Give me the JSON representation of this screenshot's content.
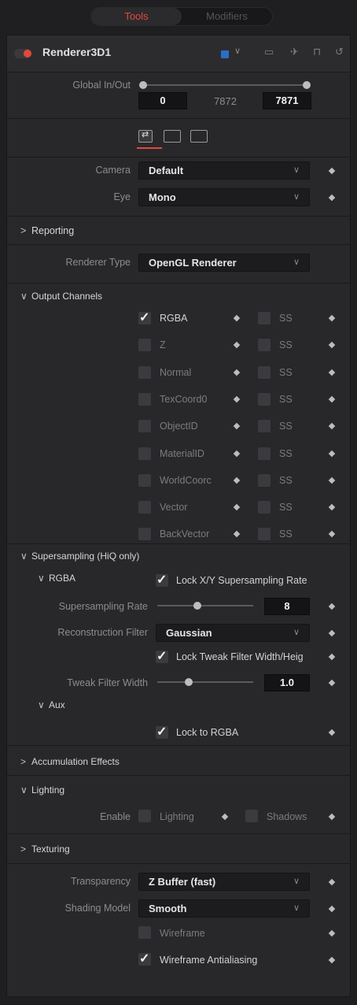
{
  "tabs": {
    "tools": "Tools",
    "modifiers": "Modifiers"
  },
  "header": {
    "title": "Renderer3D1",
    "color_chevron": "∨",
    "icons": [
      "viewer-icon",
      "pin-icon",
      "lock-icon",
      "reset-icon"
    ]
  },
  "global": {
    "label": "Global In/Out",
    "start": "0",
    "mid": "7872",
    "end": "7871"
  },
  "controls_tabs": [
    "controls-tab-icon",
    "image-tab-icon",
    "settings-tab-icon"
  ],
  "camera": {
    "label": "Camera",
    "value": "Default"
  },
  "eye": {
    "label": "Eye",
    "value": "Mono"
  },
  "reporting": {
    "label": "Reporting"
  },
  "renderer_type": {
    "label": "Renderer Type",
    "value": "OpenGL Renderer"
  },
  "output_channels": {
    "label": "Output Channels",
    "rows": [
      {
        "label": "RGBA",
        "checked": true,
        "ss": "SS"
      },
      {
        "label": "Z",
        "checked": false,
        "ss": "SS"
      },
      {
        "label": "Normal",
        "checked": false,
        "ss": "SS"
      },
      {
        "label": "TexCoord0",
        "checked": false,
        "ss": "SS"
      },
      {
        "label": "ObjectID",
        "checked": false,
        "ss": "SS"
      },
      {
        "label": "MaterialID",
        "checked": false,
        "ss": "SS"
      },
      {
        "label": "WorldCoorc",
        "checked": false,
        "ss": "SS"
      },
      {
        "label": "Vector",
        "checked": false,
        "ss": "SS"
      },
      {
        "label": "BackVector",
        "checked": false,
        "ss": "SS"
      }
    ]
  },
  "supersampling": {
    "label": "Supersampling (HiQ only)",
    "rgba": "RGBA",
    "lock_xy": "Lock X/Y Supersampling Rate",
    "rate_label": "Supersampling Rate",
    "rate_value": "8",
    "rate_fraction": 0.42,
    "filter_label": "Reconstruction Filter",
    "filter_value": "Gaussian",
    "lock_tweak": "Lock Tweak Filter Width/Heig",
    "tweak_label": "Tweak Filter Width",
    "tweak_value": "1.0",
    "tweak_fraction": 0.33,
    "aux": "Aux",
    "lock_rgba": "Lock to RGBA"
  },
  "accumulation": {
    "label": "Accumulation Effects"
  },
  "lighting": {
    "label": "Lighting",
    "enable": "Enable",
    "lighting": "Lighting",
    "shadows": "Shadows"
  },
  "texturing": {
    "label": "Texturing"
  },
  "transparency": {
    "label": "Transparency",
    "value": "Z Buffer (fast)"
  },
  "shading": {
    "label": "Shading Model",
    "value": "Smooth"
  },
  "wireframe": {
    "label": "Wireframe",
    "checked": false
  },
  "wire_aa": {
    "label": "Wireframe Antialiasing",
    "checked": true
  },
  "colors": {
    "accent": "#e3483a",
    "swatch": "#2b6ec6"
  }
}
